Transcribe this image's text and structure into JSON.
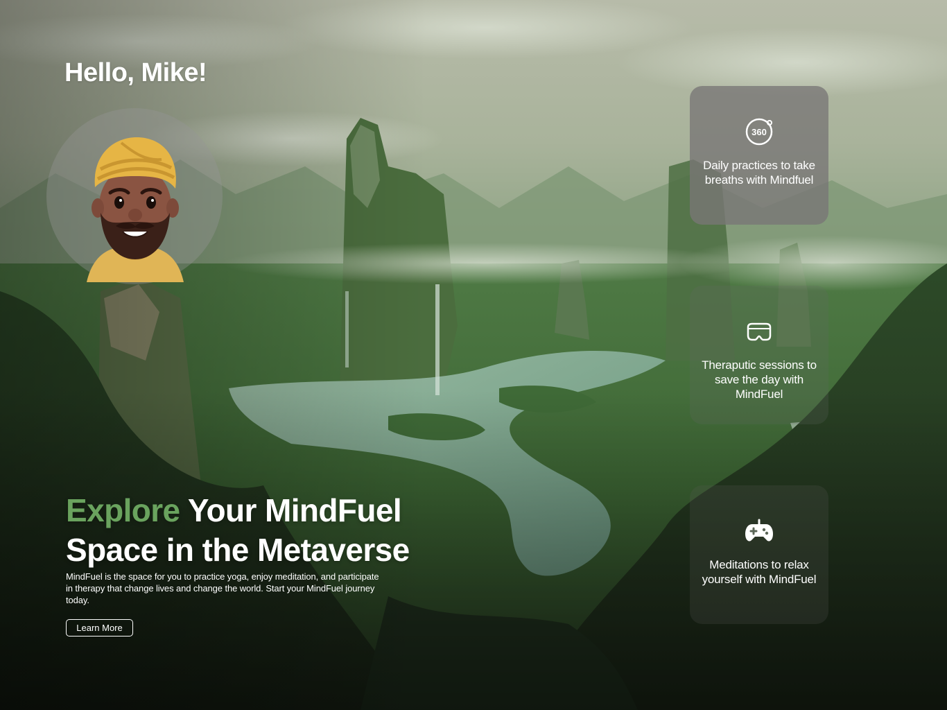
{
  "greeting": "Hello, Mike!",
  "hero": {
    "title_accent": "Explore",
    "title_rest_line1": " Your MindFuel",
    "title_line2": "Space in the Metaverse",
    "description": "MindFuel is the space for you to practice yoga, enjoy meditation, and participate in therapy that change lives and change the world. Start your MindFuel  journey today.",
    "cta_label": "Learn More"
  },
  "features": [
    {
      "icon": "360-icon",
      "text": "Daily practices to take breaths with Mindfuel"
    },
    {
      "icon": "vr-headset-icon",
      "text": "Theraputic sessions to save the day with MindFuel"
    },
    {
      "icon": "gamepad-icon",
      "text": "Meditations to relax yourself with MindFuel"
    }
  ],
  "colors": {
    "accent_green": "#6aa35e",
    "text": "#ffffff",
    "avatar_turban": "#e6b545",
    "avatar_skin": "#8a5442",
    "avatar_beard": "#3a2018"
  }
}
